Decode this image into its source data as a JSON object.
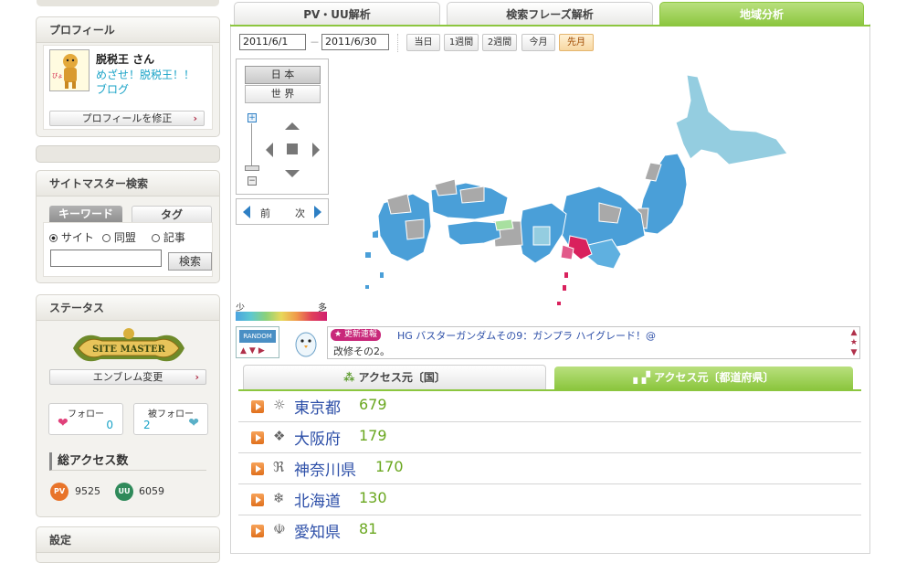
{
  "profile": {
    "title": "プロフィール",
    "user_name": "脱税王 さん",
    "blog_line1": "めざせ！脱税王！！",
    "blog_line2": "ブログ",
    "edit_button": "プロフィールを修正"
  },
  "search": {
    "title": "サイトマスター検索",
    "tab_keyword": "キーワード",
    "tab_tag": "タグ",
    "radio_site": "サイト",
    "radio_union": "同盟",
    "radio_article": "記事",
    "input_value": "",
    "button": "検索"
  },
  "status": {
    "title": "ステータス",
    "emblem_text": "SITE MASTER",
    "emblem_button": "エンブレム変更",
    "follow_label": "フォロー",
    "follow_count": "0",
    "follower_label": "被フォロー",
    "follower_count": "2",
    "total_access_title": "総アクセス数",
    "pv_label": "PV",
    "pv_value": "9525",
    "uu_label": "UU",
    "uu_value": "6059"
  },
  "settings": {
    "title": "設定"
  },
  "tabs": [
    "PV・UU解析",
    "検索フレーズ解析",
    "地域分析"
  ],
  "date_range": {
    "start": "2011/6/1",
    "separator": "－",
    "end": "2011/6/30",
    "buttons": [
      "当日",
      "1週間",
      "2週間",
      "今月",
      "先月"
    ],
    "selected": "先月"
  },
  "map": {
    "region_japan": "日 本",
    "region_world": "世 界",
    "prev": "前",
    "next": "次",
    "legend_low": "少",
    "legend_high": "多"
  },
  "news": {
    "random_label": "RANDOM",
    "badge": "★ 更新速報",
    "headline": "HG バスターガンダムその9：ガンプラ ハイグレード！@",
    "subline": "改修その2。"
  },
  "access_tabs": {
    "country": "アクセス元〔国〕",
    "prefecture": "アクセス元〔都道府県〕"
  },
  "rankings": [
    {
      "icon": "☼",
      "name": "東京都",
      "count": "679"
    },
    {
      "icon": "❖",
      "name": "大阪府",
      "count": "179"
    },
    {
      "icon": "ℜ",
      "name": "神奈川県",
      "count": "170"
    },
    {
      "icon": "❄",
      "name": "北海道",
      "count": "130"
    },
    {
      "icon": "☫",
      "name": "愛知県",
      "count": "81"
    }
  ],
  "colors": {
    "accent_green": "#8cc63f",
    "link_blue": "#2d4fa8",
    "count_green": "#6aa71f",
    "map_blue": "#4a9fd8",
    "map_gray": "#a9a9a9",
    "map_light": "#94cde0",
    "map_red": "#d9215d"
  }
}
